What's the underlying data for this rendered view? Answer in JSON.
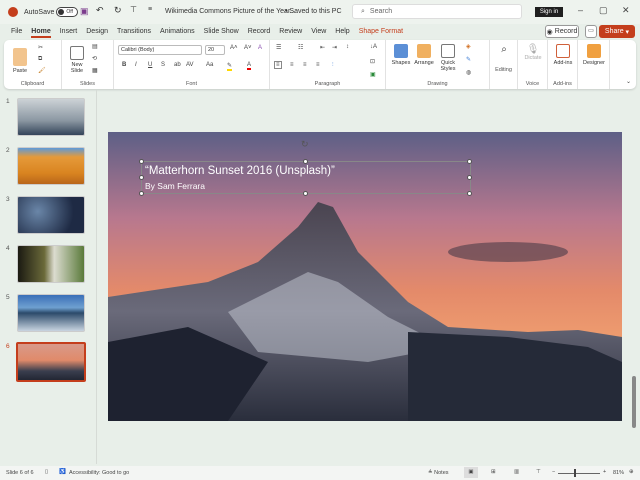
{
  "titlebar": {
    "autosave_label": "AutoSave",
    "autosave_state": "Off",
    "doc_title": "Wikimedia Commons Picture of the Year...",
    "save_status": "• Saved to this PC",
    "search_placeholder": "Search",
    "signin": "Sign in"
  },
  "tabs": [
    "File",
    "Home",
    "Insert",
    "Design",
    "Transitions",
    "Animations",
    "Slide Show",
    "Record",
    "Review",
    "View",
    "Help",
    "Shape Format"
  ],
  "actions": {
    "record": "Record",
    "share": "Share"
  },
  "ribbon": {
    "clipboard": {
      "label": "Clipboard",
      "paste": "Paste"
    },
    "slides": {
      "label": "Slides",
      "new_slide": "New Slide"
    },
    "font": {
      "label": "Font",
      "font_name": "Calibri (Body)",
      "font_size": "20",
      "bold": "B",
      "italic": "I",
      "underline": "U",
      "strike": "S",
      "case": "Aa"
    },
    "paragraph": {
      "label": "Paragraph"
    },
    "drawing": {
      "label": "Drawing",
      "shapes": "Shapes",
      "arrange": "Arrange",
      "quick_styles": "Quick Styles"
    },
    "editing": {
      "label": "Editing"
    },
    "voice": {
      "label": "Voice",
      "dictate": "Dictate"
    },
    "addins": {
      "label": "Add-ins",
      "addins": "Add-ins"
    },
    "designer": {
      "designer": "Designer"
    }
  },
  "thumbnails": [
    {
      "num": "1"
    },
    {
      "num": "2"
    },
    {
      "num": "3"
    },
    {
      "num": "4"
    },
    {
      "num": "5"
    },
    {
      "num": "6"
    }
  ],
  "slide": {
    "title": "“Matterhorn Sunset 2016 (Unsplash)”",
    "subtitle": "By Sam Ferrara"
  },
  "status": {
    "slide": "Slide 6 of 6",
    "accessibility": "Accessibility: Good to go",
    "notes": "Notes",
    "zoom": "81%",
    "zoom_level": 81
  },
  "colors": {
    "accent": "#c43e1c"
  }
}
